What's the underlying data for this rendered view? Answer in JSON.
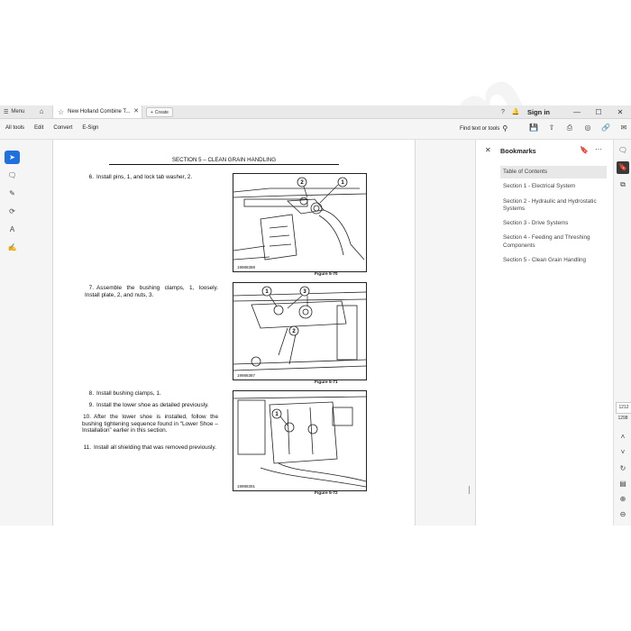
{
  "titlebar": {
    "menu_label": "Menu",
    "tab_title": "New Holland Combine T...",
    "create_label": "Create",
    "sign_in": "Sign in"
  },
  "toolbar": {
    "links": [
      "All tools",
      "Edit",
      "Convert",
      "E-Sign"
    ],
    "find_label": "Find text or tools"
  },
  "document": {
    "section_header": "SECTION 5 – CLEAN GRAIN HANDLING",
    "steps": [
      {
        "num": "6.",
        "text": "Install pins, 1, and lock tab washer, 2."
      },
      {
        "num": "7.",
        "text": "Assemble the bushing clamps, 1, loosely. Install plate, 2, and nuts, 3."
      },
      {
        "num": "8.",
        "text": "Install bushing clamps, 1."
      },
      {
        "num": "9.",
        "text": "Install the lower shoe as detailed previously."
      },
      {
        "num": "10.",
        "text": "After the lower shoe is installed, follow the bushing tightening sequence found in “Lower Shoe – Installation” earlier in this section."
      },
      {
        "num": "11.",
        "text": "Install all shielding that was removed previously."
      }
    ],
    "figures": [
      {
        "id": "19988388",
        "caption": "Figure 5-70",
        "callouts": [
          "2",
          "1"
        ]
      },
      {
        "id": "19988387",
        "caption": "Figure 5-71",
        "callouts": [
          "1",
          "3",
          "2"
        ]
      },
      {
        "id": "19988391",
        "caption": "Figure 5-72",
        "callouts": [
          "1"
        ]
      }
    ]
  },
  "watermark": "ECD2.com",
  "bookmarks": {
    "title": "Bookmarks",
    "items": [
      {
        "label": "Table of Contents",
        "selected": true
      },
      {
        "label": "Section 1 - Electrical System",
        "selected": false
      },
      {
        "label": "Section 2 - Hydraulic and Hydrostatic Systems",
        "selected": false
      },
      {
        "label": "Section 3 - Drive Systems",
        "selected": false
      },
      {
        "label": "Section 4 - Feeding and Threshing Components",
        "selected": false
      },
      {
        "label": "Section 5 - Clean Grain Handling",
        "selected": false
      }
    ]
  },
  "navigation": {
    "current_page": "1212",
    "total_pages": "1298"
  },
  "colors": {
    "accent": "#1f6fde",
    "selected_bookmark_bg": "#e8e8e8"
  }
}
